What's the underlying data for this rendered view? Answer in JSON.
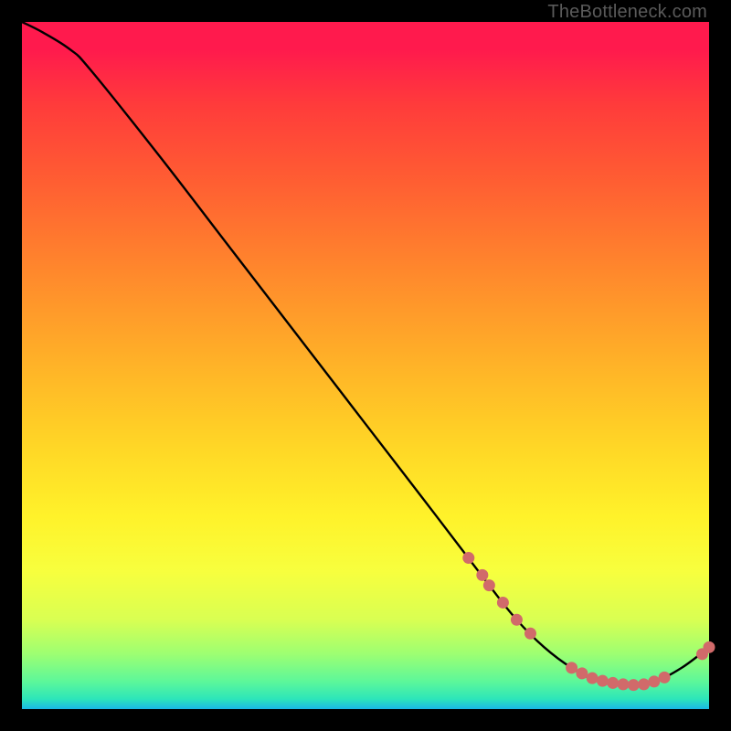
{
  "watermark": "TheBottleneck.com",
  "chart_data": {
    "type": "line",
    "title": "",
    "xlabel": "",
    "ylabel": "",
    "xlim": [
      0,
      100
    ],
    "ylim": [
      0,
      100
    ],
    "series": [
      {
        "name": "curve",
        "x": [
          0,
          3,
          7,
          10,
          20,
          30,
          40,
          50,
          60,
          68,
          72,
          76,
          80,
          84,
          88,
          92,
          96,
          100
        ],
        "y": [
          100,
          98.5,
          96,
          93,
          80.5,
          67.5,
          54.5,
          41.5,
          28.5,
          18,
          13,
          9,
          6,
          4,
          3.5,
          4,
          6,
          9
        ]
      }
    ],
    "markers": {
      "name": "highlighted-points",
      "color": "#d16a6a",
      "points": [
        {
          "x": 65,
          "y": 22
        },
        {
          "x": 67,
          "y": 19.5
        },
        {
          "x": 68,
          "y": 18
        },
        {
          "x": 70,
          "y": 15.5
        },
        {
          "x": 72,
          "y": 13
        },
        {
          "x": 74,
          "y": 11
        },
        {
          "x": 80,
          "y": 6
        },
        {
          "x": 81.5,
          "y": 5.2
        },
        {
          "x": 83,
          "y": 4.5
        },
        {
          "x": 84.5,
          "y": 4.1
        },
        {
          "x": 86,
          "y": 3.8
        },
        {
          "x": 87.5,
          "y": 3.6
        },
        {
          "x": 89,
          "y": 3.5
        },
        {
          "x": 90.5,
          "y": 3.6
        },
        {
          "x": 92,
          "y": 4
        },
        {
          "x": 93.5,
          "y": 4.6
        },
        {
          "x": 99,
          "y": 8
        },
        {
          "x": 100,
          "y": 9
        }
      ]
    },
    "gradient_stops": [
      {
        "pos": 0,
        "color": "#ff1a4d"
      },
      {
        "pos": 0.22,
        "color": "#ff5a33"
      },
      {
        "pos": 0.42,
        "color": "#ff9a2a"
      },
      {
        "pos": 0.62,
        "color": "#ffd726"
      },
      {
        "pos": 0.8,
        "color": "#f7ff3e"
      },
      {
        "pos": 0.92,
        "color": "#9dff72"
      },
      {
        "pos": 1.0,
        "color": "#1ab8e6"
      }
    ]
  }
}
